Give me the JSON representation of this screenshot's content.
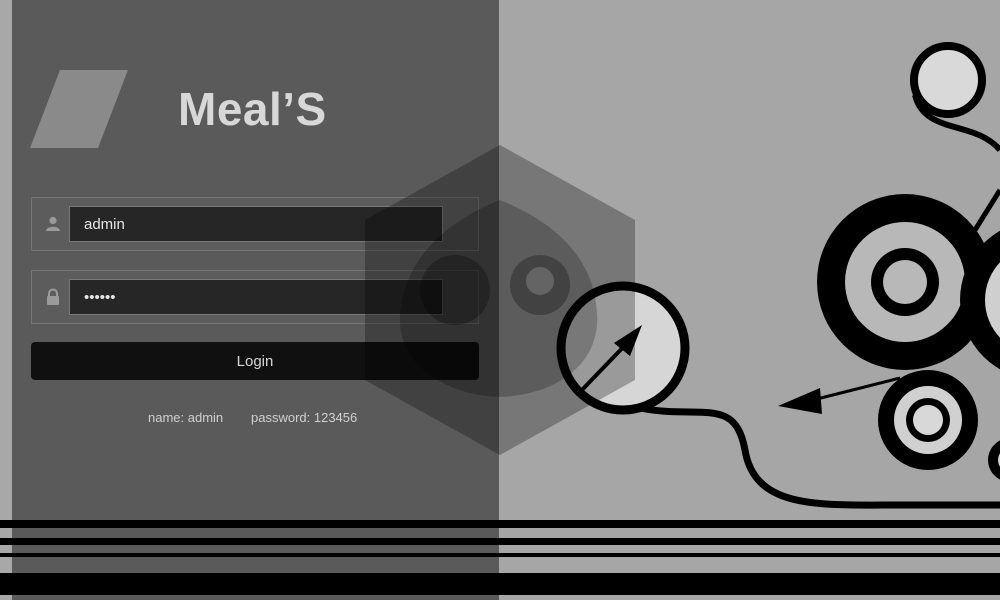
{
  "app": {
    "title": "Meal’S"
  },
  "login": {
    "username_value": "admin",
    "password_value": "123456",
    "login_label": "Login",
    "hint_name": "name: admin",
    "hint_password": "password: 123456"
  },
  "icons": {
    "username": "user-icon",
    "password": "lock-icon",
    "logo": "slash-logo-icon",
    "watermark": "hexagon-watermark-icon"
  },
  "colors": {
    "panel": "#5a5a5a",
    "background": "#a6a6a6",
    "title": "#d8d8d8",
    "button": "#101010",
    "input": "#262626"
  }
}
